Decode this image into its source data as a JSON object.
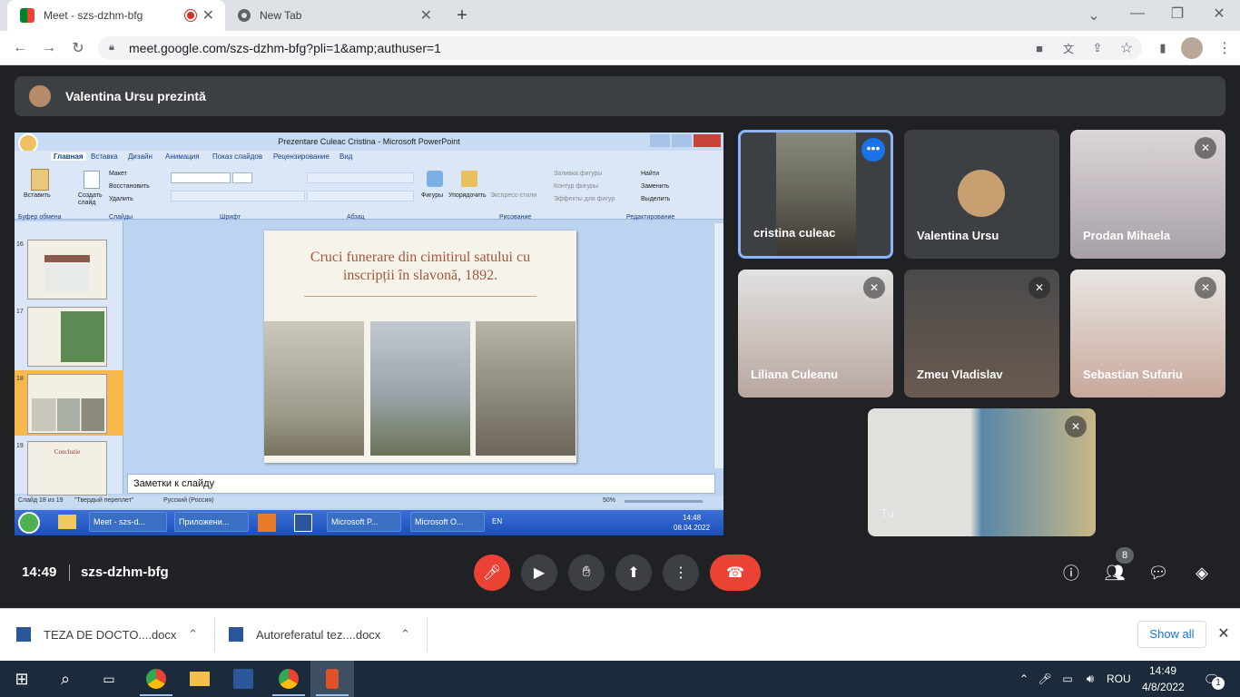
{
  "browser": {
    "tabs": [
      {
        "title": "Meet - szs-dzhm-bfg",
        "active": true
      },
      {
        "title": "New Tab",
        "active": false
      }
    ],
    "url": "meet.google.com/szs-dzhm-bfg?pli=1&amp;authuser=1"
  },
  "meet": {
    "presenter_banner": "Valentina Ursu prezintă",
    "time": "14:49",
    "meeting_code": "szs-dzhm-bfg",
    "participant_count": "8",
    "participants": [
      {
        "name": "cristina culeac"
      },
      {
        "name": "Valentina Ursu"
      },
      {
        "name": "Prodan Mihaela"
      },
      {
        "name": "Liliana Culeanu"
      },
      {
        "name": "Zmeu Vladislav"
      },
      {
        "name": "Sebastian Sufariu"
      },
      {
        "name": "Tu"
      }
    ]
  },
  "powerpoint": {
    "window_title": "Prezentare Culeac Cristina - Microsoft PowerPoint",
    "ribbon_tabs": [
      "Главная",
      "Вставка",
      "Дизайн",
      "Анимация",
      "Показ слайдов",
      "Рецензирование",
      "Вид"
    ],
    "ribbon_groups": [
      "Буфер обмена",
      "Слайды",
      "Шрифт",
      "Абзац",
      "Рисование",
      "Редактирование"
    ],
    "ribbon_buttons": {
      "paste": "Вставить",
      "create_slide": "Создать слайд",
      "layout": "Макет",
      "reset": "Восстановить",
      "delete": "Удалить",
      "shapes": "Фигуры",
      "arrange": "Упорядочить",
      "quick_styles": "Экспресс-стили",
      "fill": "Заливка фигуры",
      "outline": "Контур фигуры",
      "effects": "Эффекты для фигур",
      "find": "Найти",
      "replace": "Заменить",
      "select": "Выделить"
    },
    "slide_numbers": [
      "16",
      "17",
      "18",
      "19"
    ],
    "thumb_19_title": "Concluzie",
    "slide_title": "Cruci funerare din cimitirul satului cu inscripții în slavonă, 1892.",
    "notes_placeholder": "Заметки к слайду",
    "status": {
      "slide_of": "Слайд 18 из 19",
      "theme": "\"Твердый переплет\"",
      "language": "Русский (Россия)",
      "zoom": "50%"
    },
    "taskbar": {
      "items": [
        "Meet - szs-d...",
        "Приложени...",
        "Microsoft P...",
        "Microsoft O..."
      ],
      "lang": "EN",
      "time": "14:48",
      "date": "08.04.2022"
    }
  },
  "downloads": {
    "items": [
      "TEZA DE DOCTO....docx",
      "Autoreferatul tez....docx"
    ],
    "show_all": "Show all"
  },
  "windows_taskbar": {
    "lang": "ROU",
    "time": "14:49",
    "date": "4/8/2022",
    "notifications": "1"
  },
  "colors": {
    "meet_bg": "#202124",
    "end_call": "#ea4335",
    "active_tile_border": "#8ab4f8"
  }
}
